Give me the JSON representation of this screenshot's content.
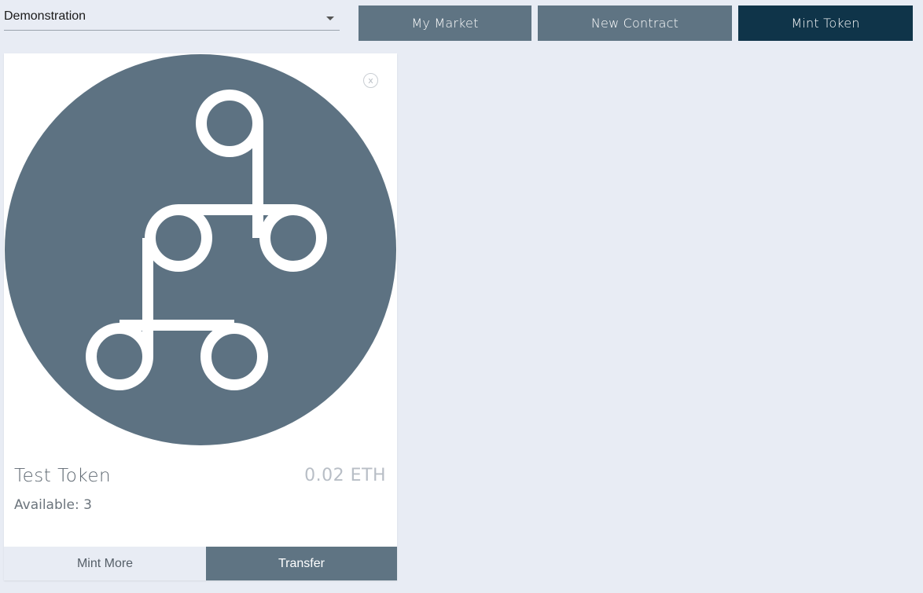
{
  "select": {
    "value": "Demonstration"
  },
  "nav": {
    "my_market": "My Market",
    "new_contract": "New Contract",
    "mint_token": "Mint Token"
  },
  "token": {
    "name": "Test Token",
    "price": "0.02 ETH",
    "available": "Available: 3",
    "close_glyph": "x",
    "icon": "node-network-icon"
  },
  "actions": {
    "mint_more": "Mint More",
    "transfer": "Transfer"
  },
  "colors": {
    "background": "#e8ecf4",
    "button_muted": "#5f7483",
    "button_active": "#0f3449",
    "token_circle": "#5d7282"
  }
}
